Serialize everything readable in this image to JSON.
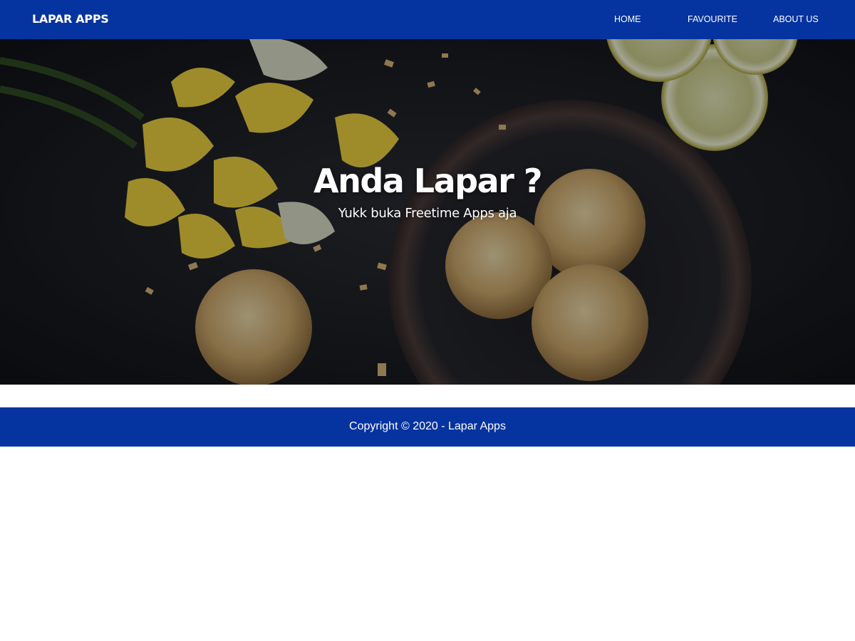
{
  "navbar": {
    "brand": "LAPAR APPS",
    "links": [
      {
        "label": "HOME"
      },
      {
        "label": "FAVOURITE"
      },
      {
        "label": "ABOUT US"
      }
    ]
  },
  "hero": {
    "title": "Anda Lapar ?",
    "subtitle": "Yukk buka Freetime Apps aja"
  },
  "footer": {
    "copyright": "Copyright © 2020 - Lapar Apps"
  },
  "colors": {
    "primary": "#0533a0",
    "text_light": "#ffffff",
    "page_bg": "#ffffff"
  }
}
